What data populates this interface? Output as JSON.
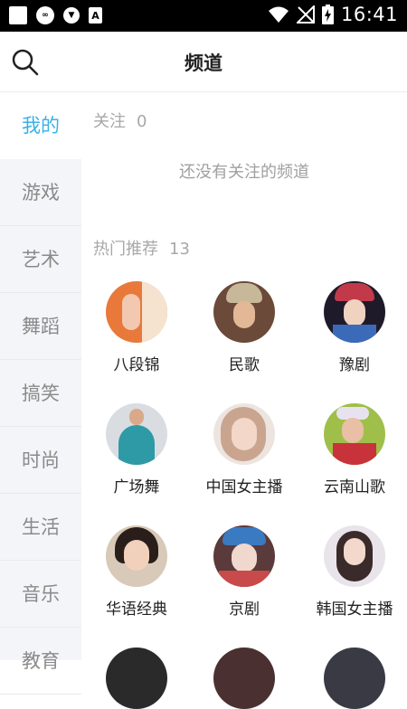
{
  "status_bar": {
    "time": "16:41"
  },
  "header": {
    "title": "频道"
  },
  "sidebar": {
    "items": [
      {
        "label": "我的",
        "active": true
      },
      {
        "label": "游戏"
      },
      {
        "label": "艺术"
      },
      {
        "label": "舞蹈"
      },
      {
        "label": "搞笑"
      },
      {
        "label": "时尚"
      },
      {
        "label": "生活"
      },
      {
        "label": "音乐"
      },
      {
        "label": "教育"
      }
    ]
  },
  "following": {
    "label": "关注",
    "count": "0",
    "empty_text": "还没有关注的频道"
  },
  "hot": {
    "label": "热门推荐",
    "count": "13",
    "channels": [
      {
        "name": "八段锦"
      },
      {
        "name": "民歌"
      },
      {
        "name": "豫剧"
      },
      {
        "name": "广场舞"
      },
      {
        "name": "中国女主播"
      },
      {
        "name": "云南山歌"
      },
      {
        "name": "华语经典"
      },
      {
        "name": "京剧"
      },
      {
        "name": "韩国女主播"
      }
    ]
  },
  "colors": {
    "accent": "#3ab0e6",
    "sidebar_bg": "#f4f5f8",
    "muted_text": "#a8a8a8"
  },
  "icons": {
    "search": "search-icon"
  }
}
